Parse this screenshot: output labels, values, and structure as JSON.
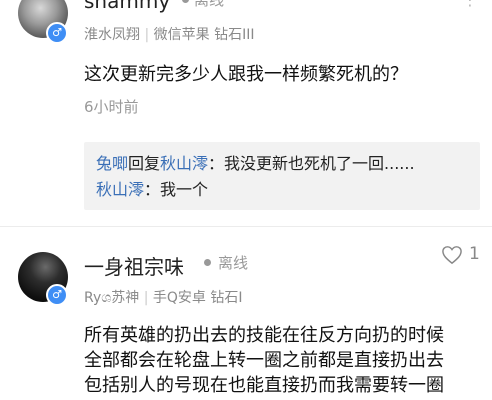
{
  "comment1": {
    "username": "shammy",
    "status": "离线",
    "meta": {
      "name": "淮水凤翔",
      "separator": "|",
      "platform": "微信苹果",
      "rank": "钻石III"
    },
    "text": "这次更新完多少人跟我一样频繁死机的？",
    "time": "6小时前",
    "replies": [
      {
        "from": "兔唧",
        "verb": "回复",
        "to": "秋山澪",
        "text": "：我没更新也死机了一回......"
      },
      {
        "from": "秋山澪",
        "text": "：我一个"
      }
    ]
  },
  "comment2": {
    "username": "一身祖宗味",
    "status": "离线",
    "like_count": "1",
    "meta": {
      "name": "Ryශ苏神",
      "separator": "|",
      "platform": "手Q安卓",
      "rank": "钻石I"
    },
    "text_lines": [
      "所有英雄的扔出去的技能在往反方向扔的时候",
      "全部都会在轮盘上转一圈之前都是直接扔出去",
      "包括别人的号现在也能直接扔而我需要转一圈"
    ]
  },
  "colors": {
    "link": "#3a6fb7",
    "gender_badge": "#3f8ef5",
    "meta_gray": "#8a8a8a"
  },
  "icons": {
    "more": "more-icon",
    "heart": "heart-outline-icon",
    "male": "male-gender-icon"
  }
}
